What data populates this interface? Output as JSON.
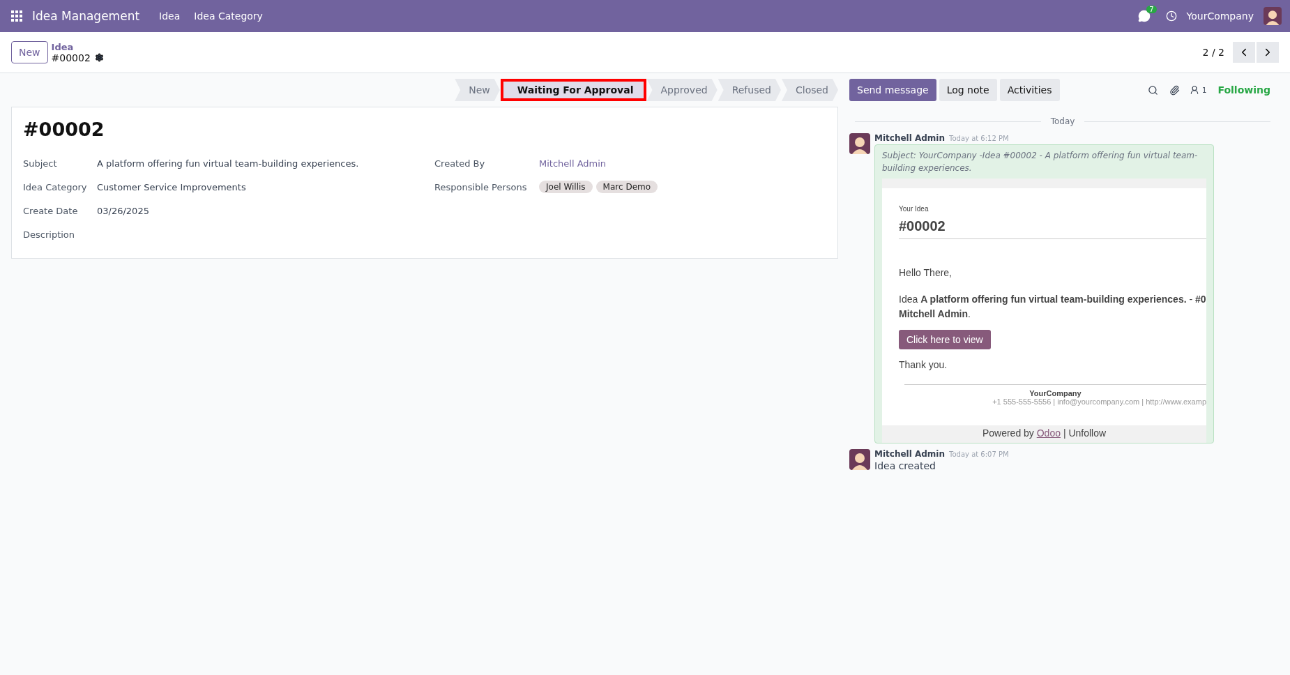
{
  "navbar": {
    "app_title": "Idea Management",
    "menu": [
      "Idea",
      "Idea Category"
    ],
    "messages_badge": "7",
    "company": "YourCompany"
  },
  "control_panel": {
    "new_button": "New",
    "breadcrumb": "Idea",
    "record": "#00002",
    "pager": "2 / 2"
  },
  "stages": [
    {
      "label": "New",
      "selected": false,
      "highlighted": false
    },
    {
      "label": "Waiting For Approval",
      "selected": true,
      "highlighted": true
    },
    {
      "label": "Approved",
      "selected": false,
      "highlighted": false
    },
    {
      "label": "Refused",
      "selected": false,
      "highlighted": false
    },
    {
      "label": "Closed",
      "selected": false,
      "highlighted": false
    }
  ],
  "form": {
    "title": "#00002",
    "left_fields": [
      {
        "label": "Subject",
        "value": "A platform offering fun virtual team-building experiences."
      },
      {
        "label": "Idea Category",
        "value": "Customer Service Improvements"
      },
      {
        "label": "Create Date",
        "value": "03/26/2025"
      },
      {
        "label": "Description"
      }
    ],
    "right_fields": [
      {
        "label": "Created By",
        "kind": "link",
        "value": "Mitchell Admin"
      },
      {
        "label": "Responsible Persons",
        "kind": "tags",
        "tags": [
          "Joel Willis",
          "Marc Demo"
        ]
      }
    ]
  },
  "chatter": {
    "buttons": [
      {
        "label": "Send message",
        "selected": true
      },
      {
        "label": "Log note",
        "selected": false
      },
      {
        "label": "Activities",
        "selected": false
      }
    ],
    "followers_count": "1",
    "following": "Following",
    "date_separator": "Today",
    "messages": [
      {
        "kind": "email",
        "author": "Mitchell Admin",
        "time": "Today at 6:12 PM",
        "subject": "Subject: YourCompany -Idea #00002 - A platform offering fun virtual team-building experiences.",
        "email": {
          "caption": "Your Idea",
          "number": "#00002",
          "greeting": "Hello There,",
          "line_1": "Idea **A platform offering fun virtual team-building experiences.** - **#0**",
          "line_2": "**Mitchell Admin**.",
          "button": "Click here to view",
          "thanks": "Thank you.",
          "company": "YourCompany",
          "contact": "+1 555-555-5556 | info@yourcompany.com | http://www.examp",
          "powered_by": "Powered by",
          "odoo": "Odoo",
          "unfollow": "| Unfollow"
        }
      },
      {
        "kind": "note",
        "author": "Mitchell Admin",
        "time": "Today at 6:07 PM",
        "body": "Idea created"
      }
    ]
  }
}
